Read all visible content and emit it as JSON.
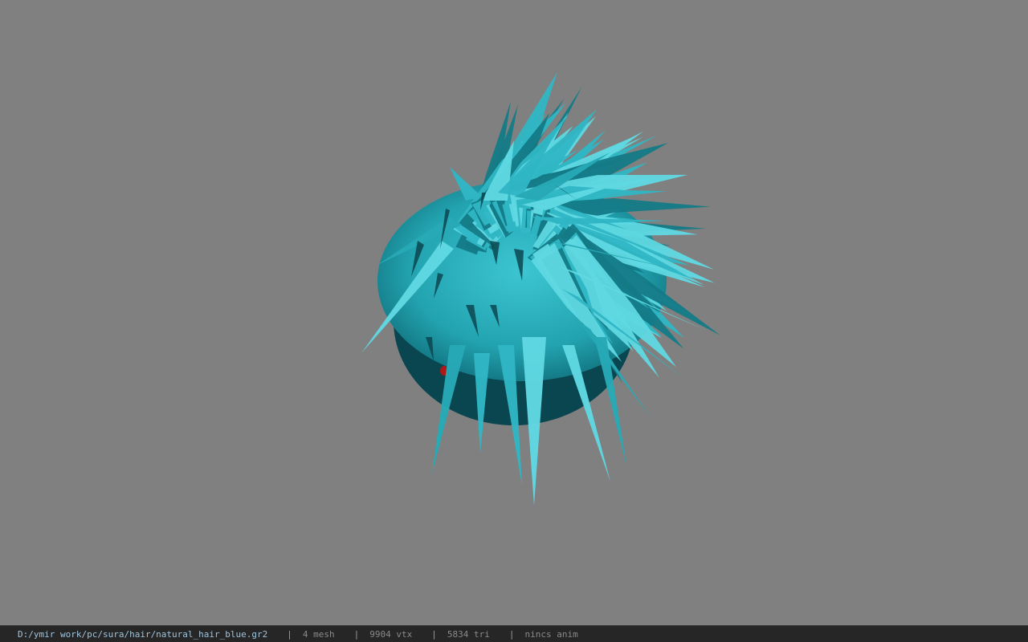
{
  "viewport": {
    "background_color": "#808080",
    "model_icon": "hair-mesh-icon",
    "model_colors": {
      "hair_base": "#2fb6c4",
      "hair_light": "#5fd8e2",
      "hair_dark": "#137a86",
      "hair_shadow": "#0a4650",
      "accent_red": "#b01818"
    }
  },
  "status_bar": {
    "file_path": "D:/ymir work/pc/sura/hair/natural_hair_blue.gr2",
    "separator": "|",
    "mesh_count": "4 mesh",
    "vertex_count": "9904 vtx",
    "triangle_count": "5834 tri",
    "anim_label": "nincs anim",
    "background_color": "#262626",
    "path_color": "#9fc4dc"
  }
}
